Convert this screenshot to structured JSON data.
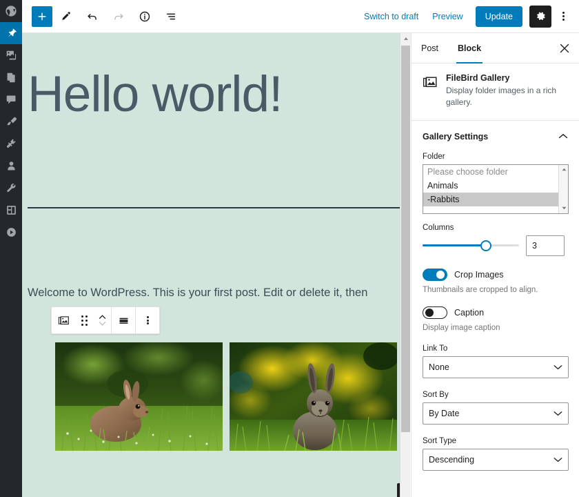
{
  "admin_sidebar": {
    "items": [
      {
        "name": "wordpress-logo",
        "icon": "wordpress-icon",
        "active": false
      },
      {
        "name": "posts",
        "icon": "pin-icon",
        "active": true
      },
      {
        "name": "media",
        "icon": "media-icon",
        "active": false
      },
      {
        "name": "pages",
        "icon": "pages-icon",
        "active": false
      },
      {
        "name": "comments",
        "icon": "comment-icon",
        "active": false
      },
      {
        "name": "appearance",
        "icon": "brush-icon",
        "active": false
      },
      {
        "name": "plugins",
        "icon": "plug-icon",
        "active": false
      },
      {
        "name": "users",
        "icon": "user-icon",
        "active": false
      },
      {
        "name": "tools",
        "icon": "wrench-icon",
        "active": false
      },
      {
        "name": "settings",
        "icon": "sliders-icon",
        "active": false
      },
      {
        "name": "media-player",
        "icon": "play-circle-icon",
        "active": false
      }
    ]
  },
  "header": {
    "tools": [
      {
        "name": "add-block-button",
        "icon": "plus-icon",
        "primary": true,
        "disabled": false
      },
      {
        "name": "tools-button",
        "icon": "pencil-icon",
        "primary": false,
        "disabled": false
      },
      {
        "name": "undo-button",
        "icon": "undo-icon",
        "primary": false,
        "disabled": false
      },
      {
        "name": "redo-button",
        "icon": "redo-icon",
        "primary": false,
        "disabled": true
      },
      {
        "name": "details-button",
        "icon": "info-icon",
        "primary": false,
        "disabled": false
      },
      {
        "name": "list-view-button",
        "icon": "list-view-icon",
        "primary": false,
        "disabled": false
      }
    ],
    "switch_to_draft": "Switch to draft",
    "preview": "Preview",
    "update": "Update",
    "settings_icon": "gear-icon",
    "more_icon": "kebab-menu-icon",
    "accent_color": "#007cba"
  },
  "editor": {
    "background_color": "#d2e5dd",
    "title": "Hello world!",
    "paragraph": "Welcome to WordPress. This is your first post. Edit or delete it, then",
    "block_toolbar": [
      {
        "name": "block-type-gallery-button",
        "icon": "gallery-icon"
      },
      {
        "name": "drag-handle",
        "icon": "drag-dots-icon"
      },
      {
        "name": "move-up-down-button",
        "icon": "chevron-up-down-icon"
      },
      {
        "name": "align-button",
        "icon": "align-wide-icon"
      },
      {
        "name": "block-options-button",
        "icon": "vertical-dots-icon"
      }
    ],
    "gallery": [
      {
        "name": "gallery-image-1",
        "alt": "Brown rabbit sitting in green grass"
      },
      {
        "name": "gallery-image-2",
        "alt": "Rabbit facing forward with yellow flowers behind"
      }
    ],
    "appender_icon": "plus-icon"
  },
  "sidebar": {
    "tabs": [
      {
        "label": "Post",
        "active": false
      },
      {
        "label": "Block",
        "active": true
      }
    ],
    "close_icon": "close-icon",
    "block_card": {
      "icon": "gallery-icon",
      "title": "FileBird Gallery",
      "description": "Display folder images in a rich gallery."
    },
    "panel": {
      "title": "Gallery Settings",
      "chevron_icon": "chevron-up-icon",
      "expanded": true
    },
    "folder": {
      "label": "Folder",
      "options": [
        {
          "label": "Please choose folder",
          "placeholder": true,
          "selected": false
        },
        {
          "label": "Animals",
          "placeholder": false,
          "selected": false
        },
        {
          "label": "-Rabbits",
          "placeholder": false,
          "selected": true
        }
      ]
    },
    "columns": {
      "label": "Columns",
      "value": "3",
      "fill_percent": 66
    },
    "crop_images": {
      "label": "Crop Images",
      "on": true,
      "help": "Thumbnails are cropped to align."
    },
    "caption": {
      "label": "Caption",
      "on": false,
      "help": "Display image caption"
    },
    "link_to": {
      "label": "Link To",
      "value": "None",
      "chevron_icon": "chevron-down-icon"
    },
    "sort_by": {
      "label": "Sort By",
      "value": "By Date",
      "chevron_icon": "chevron-down-icon"
    },
    "sort_type": {
      "label": "Sort Type",
      "value": "Descending",
      "chevron_icon": "chevron-down-icon"
    }
  }
}
